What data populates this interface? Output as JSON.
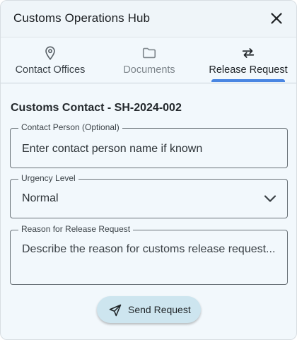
{
  "header": {
    "title": "Customs Operations Hub",
    "close_icon": "close-icon"
  },
  "tabs": [
    {
      "label": "Contact Offices",
      "icon": "location-pin-icon",
      "selected": false
    },
    {
      "label": "Documents",
      "icon": "folder-icon",
      "selected": false
    },
    {
      "label": "Release Request",
      "icon": "swap-arrows-icon",
      "selected": true
    }
  ],
  "form": {
    "section_title": "Customs Contact - SH-2024-002",
    "contact_person": {
      "label": "Contact Person (Optional)",
      "placeholder": "Enter contact person name if known"
    },
    "urgency": {
      "label": "Urgency Level",
      "value": "Normal",
      "icon": "chevron-down-icon"
    },
    "reason": {
      "label": "Reason for Release Request",
      "placeholder": "Describe the reason for customs release request..."
    },
    "send_button": {
      "label": "Send Request",
      "icon": "send-icon"
    }
  },
  "colors": {
    "accent": "#4a86e2",
    "background": "#f2f8fc",
    "button": "#cde5ef"
  }
}
